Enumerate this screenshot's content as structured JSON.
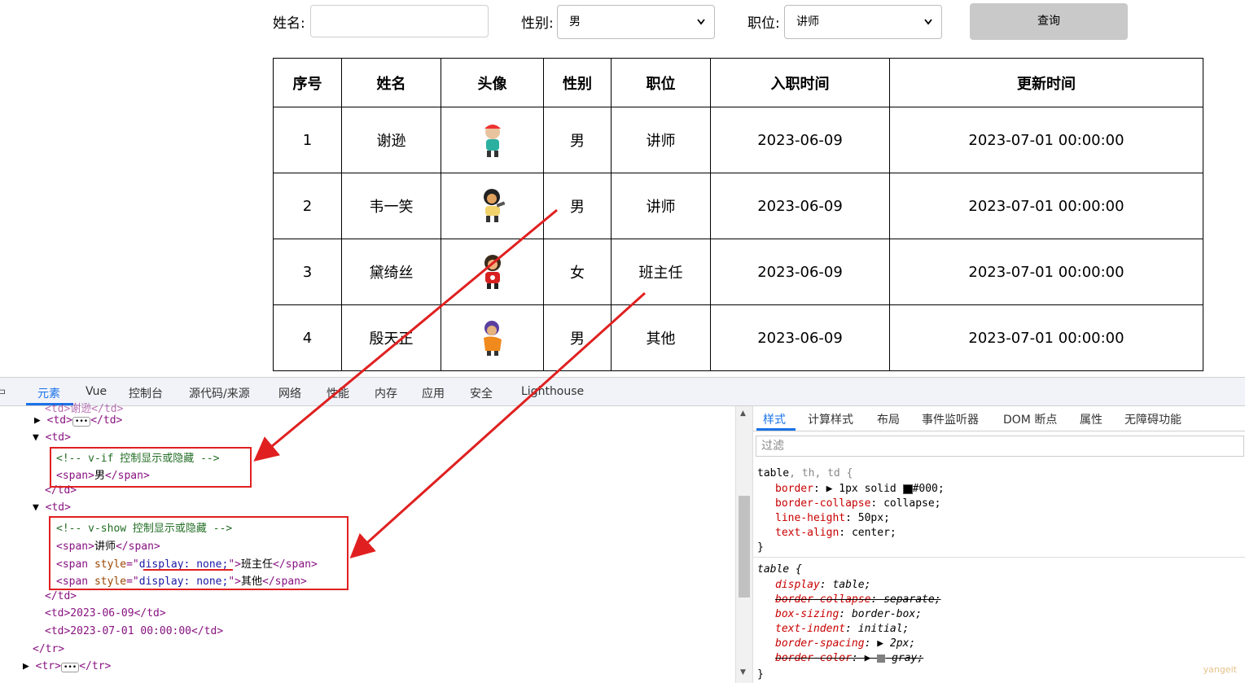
{
  "search": {
    "name_label": "姓名:",
    "name_value": "",
    "gender_label": "性别:",
    "gender_selected": "男",
    "job_label": "职位:",
    "job_selected": "讲师",
    "query_label": "查询"
  },
  "table": {
    "headers": [
      "序号",
      "姓名",
      "头像",
      "性别",
      "职位",
      "入职时间",
      "更新时间"
    ],
    "rows": [
      {
        "id": "1",
        "name": "谢逊",
        "gender": "男",
        "job": "讲师",
        "entry": "2023-06-09",
        "update": "2023-07-01 00:00:00"
      },
      {
        "id": "2",
        "name": "韦一笑",
        "gender": "男",
        "job": "讲师",
        "entry": "2023-06-09",
        "update": "2023-07-01 00:00:00"
      },
      {
        "id": "3",
        "name": "黛绮丝",
        "gender": "女",
        "job": "班主任",
        "entry": "2023-06-09",
        "update": "2023-07-01 00:00:00"
      },
      {
        "id": "4",
        "name": "殷天正",
        "gender": "男",
        "job": "其他",
        "entry": "2023-06-09",
        "update": "2023-07-01 00:00:00"
      }
    ]
  },
  "devtools": {
    "tabs": [
      "元素",
      "Vue",
      "控制台",
      "源代码/来源",
      "网络",
      "性能",
      "内存",
      "应用",
      "安全",
      "Lighthouse"
    ],
    "side_tabs": [
      "样式",
      "计算样式",
      "布局",
      "事件监听器",
      "DOM 断点",
      "属性",
      "无障碍功能"
    ],
    "filter_placeholder": "过滤",
    "code_lines": {
      "l0": "<td>谢逊</td>",
      "l1_open": "<td>",
      "l1_close": "</td>",
      "l2": "<td>",
      "l3": "<!-- v-if 控制显示或隐藏 -->",
      "l4_text": "男",
      "l5": "</td>",
      "l6": "<td>",
      "l7": "<!-- v-show 控制显示或隐藏 -->",
      "l8_text": "讲师",
      "l9_attr_val": "display: none;",
      "l9_text": "班主任",
      "l10_text": "其他",
      "l11": "</td>",
      "l12": "<td>2023-06-09</td>",
      "l13": "<td>2023-07-01 00:00:00</td>",
      "l14": "</tr>",
      "l15_open": "<tr>",
      "l15_close": "</tr>"
    },
    "css_rules": {
      "r1_selector_main": "table",
      "r1_selector_rest": ", th, td {",
      "r1_border_prop": "border",
      "r1_border_val_a": "1px solid",
      "r1_border_val_b": "#000;",
      "r1_collapse": "collapse;",
      "r1_lh": "50px;",
      "r1_ta": "center;",
      "r2_selector": "table {",
      "r2_display": "table;",
      "r2_bc": "separate;",
      "r2_bs": "border-box;",
      "r2_ti": "initial;",
      "r2_bsp": "2px;",
      "r2_bcol": "gray;"
    },
    "colors": {
      "accent": "#1a73e8",
      "annotation": "#e02020",
      "swatch_black": "#000000",
      "swatch_gray": "#808080"
    }
  },
  "watermark": "yangeit"
}
